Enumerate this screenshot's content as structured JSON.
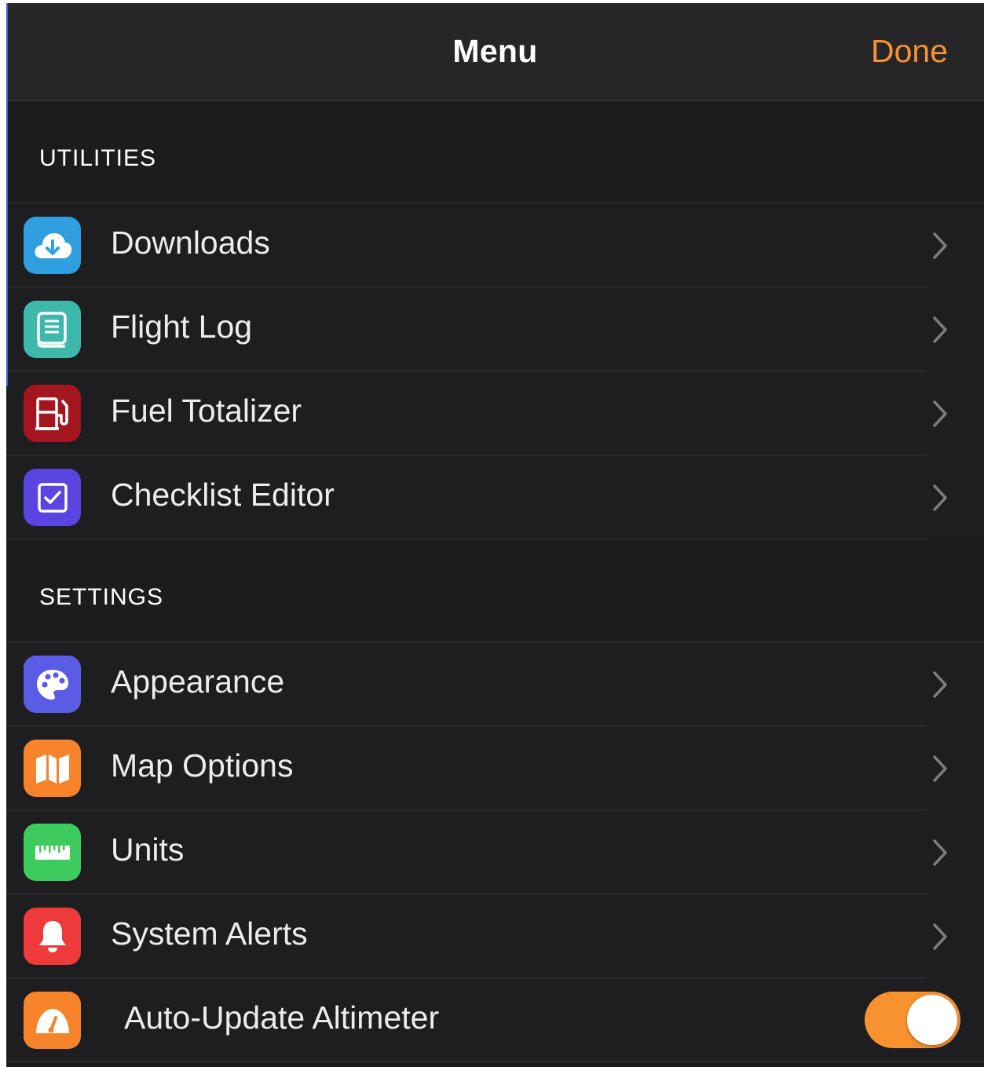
{
  "nav": {
    "title": "Menu",
    "done_label": "Done",
    "accent_color": "#f7922f"
  },
  "utilities": {
    "header": "UTILITIES",
    "items": [
      {
        "label": "Downloads",
        "icon": "cloud-download-icon",
        "icon_bg": "#2f9fe0"
      },
      {
        "label": "Flight Log",
        "icon": "logbook-icon",
        "icon_bg": "#3fb8ac"
      },
      {
        "label": "Fuel Totalizer",
        "icon": "fuel-pump-icon",
        "icon_bg": "#a3151f"
      },
      {
        "label": "Checklist Editor",
        "icon": "checklist-icon",
        "icon_bg": "#5b45e0"
      }
    ]
  },
  "settings": {
    "header": "SETTINGS",
    "items": [
      {
        "label": "Appearance",
        "icon": "palette-icon",
        "icon_bg": "#5b5ce6"
      },
      {
        "label": "Map Options",
        "icon": "map-icon",
        "icon_bg": "#f7832a"
      },
      {
        "label": "Units",
        "icon": "ruler-icon",
        "icon_bg": "#3ecb5e"
      },
      {
        "label": "System Alerts",
        "icon": "bell-icon",
        "icon_bg": "#ee3a3a"
      },
      {
        "label": "Auto-Update Altimeter",
        "icon": "altimeter-gauge-icon",
        "icon_bg": "#f7832a",
        "toggle_on": true
      }
    ]
  }
}
